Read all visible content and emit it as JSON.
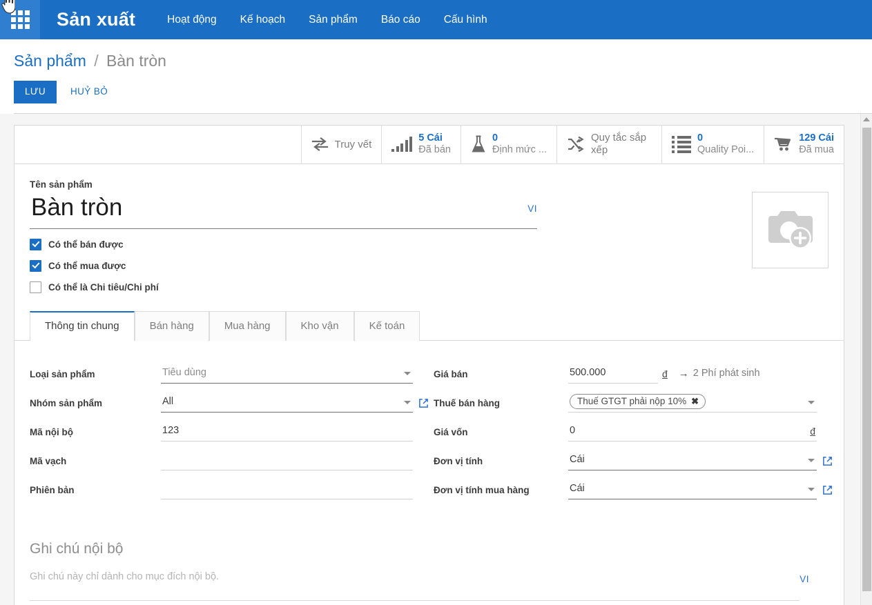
{
  "navbar": {
    "apps_icon": "apps-grid-icon",
    "brand": "Sản xuất",
    "links": [
      {
        "label": "Hoạt động"
      },
      {
        "label": "Kế hoạch"
      },
      {
        "label": "Sản phẩm"
      },
      {
        "label": "Báo cáo"
      },
      {
        "label": "Cấu hình"
      }
    ],
    "accent_color": "#1a6ec4"
  },
  "breadcrumb": {
    "parent": "Sản phẩm",
    "separator": "/",
    "current": "Bàn tròn"
  },
  "actions": {
    "save_label": "LƯU",
    "cancel_label": "HUỶ BỎ"
  },
  "statbar": [
    {
      "icon": "exchange-arrows-icon",
      "value": "",
      "label": "Truy vết"
    },
    {
      "icon": "bar-chart-icon",
      "value": "5 Cái",
      "label": "Đã bán"
    },
    {
      "icon": "flask-icon",
      "value": "0",
      "label": "Định mức ..."
    },
    {
      "icon": "shuffle-icon",
      "value": "",
      "label": "Quy tắc sắp xếp"
    },
    {
      "icon": "list-icon",
      "value": "0",
      "label": "Quality Poi..."
    },
    {
      "icon": "shopping-cart-icon",
      "value": "129 Cái",
      "label": "Đã mua"
    }
  ],
  "product": {
    "name_label": "Tên sản phẩm",
    "name_value": "Bàn tròn",
    "lang_badge": "VI",
    "photo_icon": "camera-add-icon",
    "checkboxes": [
      {
        "label": "Có thể bán được",
        "checked": true
      },
      {
        "label": "Có thể mua được",
        "checked": true
      },
      {
        "label": "Có thể là Chi tiêu/Chi phí",
        "checked": false
      }
    ]
  },
  "tabs": [
    {
      "label": "Thông tin chung",
      "active": true
    },
    {
      "label": "Bán hàng",
      "active": false
    },
    {
      "label": "Mua hàng",
      "active": false
    },
    {
      "label": "Kho vận",
      "active": false
    },
    {
      "label": "Kế toán",
      "active": false
    }
  ],
  "left_fields": [
    {
      "label": "Loại sản phẩm",
      "value": "Tiêu dùng"
    },
    {
      "label": "Nhóm sản phẩm",
      "value": "All"
    },
    {
      "label": "Mã nội bộ",
      "value": "123"
    },
    {
      "label": "Mã vạch",
      "value": ""
    },
    {
      "label": "Phiên bản",
      "value": ""
    }
  ],
  "right_fields": {
    "price_label": "Giá bán",
    "price_value": "500.000",
    "price_currency": "đ",
    "fee_arrow": "→",
    "fee_label": "2 Phí phát sinh",
    "tax_label": "Thuế bán hàng",
    "tax_tag": "Thuế GTGT phải nộp 10%",
    "tax_tag_remove": "✖",
    "cost_label": "Giá vốn",
    "cost_value": "0",
    "cost_currency": "đ",
    "uom_label": "Đơn vị tính",
    "uom_value": "Cái",
    "puom_label": "Đơn vị tính mua hàng",
    "puom_value": "Cái"
  },
  "notes": {
    "title": "Ghi chú nội bộ",
    "placeholder": "Ghi chú này chỉ dành cho mục đích nội bộ.",
    "lang_badge": "VI"
  }
}
